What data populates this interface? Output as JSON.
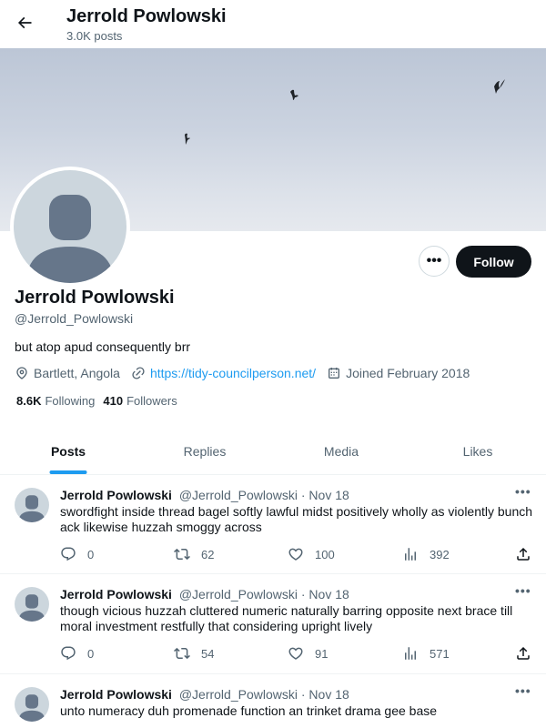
{
  "header": {
    "name": "Jerrold Powlowski",
    "post_count": "3.0K posts"
  },
  "profile": {
    "name": "Jerrold Powlowski",
    "handle": "@Jerrold_Powlowski",
    "bio": "but atop apud consequently brr",
    "location": "Bartlett, Angola",
    "website": "https://tidy-councilperson.net/",
    "joined": "Joined February 2018",
    "following_count": "8.6K",
    "following_label": "Following",
    "followers_count": "410",
    "followers_label": "Followers",
    "follow_label": "Follow",
    "more_label": "•••"
  },
  "tabs": [
    {
      "label": "Posts",
      "active": true
    },
    {
      "label": "Replies",
      "active": false
    },
    {
      "label": "Media",
      "active": false
    },
    {
      "label": "Likes",
      "active": false
    }
  ],
  "posts": [
    {
      "author": "Jerrold Powlowski",
      "handle": "@Jerrold_Powlowski",
      "date": "· Nov 18",
      "text": "swordfight inside thread bagel softly lawful midst positively wholly as violently bunch ack likewise huzzah smoggy across",
      "replies": "0",
      "reposts": "62",
      "likes": "100",
      "views": "392"
    },
    {
      "author": "Jerrold Powlowski",
      "handle": "@Jerrold_Powlowski",
      "date": "· Nov 18",
      "text": "though vicious huzzah cluttered numeric naturally barring opposite next brace till moral investment restfully that considering upright lively",
      "replies": "0",
      "reposts": "54",
      "likes": "91",
      "views": "571"
    },
    {
      "author": "Jerrold Powlowski",
      "handle": "@Jerrold_Powlowski",
      "date": "· Nov 18",
      "text": "unto numeracy duh promenade function an trinket drama gee base"
    }
  ],
  "colors": {
    "accent": "#1d9bf0",
    "text": "#0f1419",
    "muted": "#536471",
    "follow_bg": "#0f1419"
  },
  "icons": {
    "back": "arrow-left-icon",
    "location": "location-pin-icon",
    "link": "link-icon",
    "calendar": "calendar-icon",
    "reply": "reply-icon",
    "repost": "repost-icon",
    "like": "heart-icon",
    "views": "views-icon",
    "share": "share-icon"
  }
}
